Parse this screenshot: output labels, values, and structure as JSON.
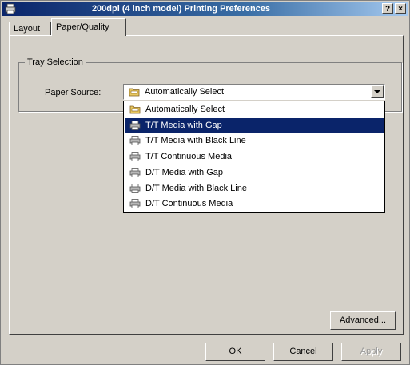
{
  "window": {
    "title": "200dpi (4 inch model) Printing Preferences",
    "help_label": "?",
    "close_label": "×"
  },
  "tabs": [
    {
      "label": "Layout"
    },
    {
      "label": "Paper/Quality"
    }
  ],
  "tray_selection": {
    "group_label": "Tray Selection",
    "paper_source_label": "Paper Source:",
    "selected_value": "Automatically Select",
    "options": [
      {
        "label": "Automatically Select",
        "icon": "folder-tray-icon"
      },
      {
        "label": "T/T  Media with Gap",
        "icon": "printer-icon",
        "selected": true
      },
      {
        "label": "T/T  Media with Black Line",
        "icon": "printer-icon"
      },
      {
        "label": "T/T  Continuous Media",
        "icon": "printer-icon"
      },
      {
        "label": "D/T  Media with Gap",
        "icon": "printer-icon"
      },
      {
        "label": "D/T  Media with Black Line",
        "icon": "printer-icon"
      },
      {
        "label": "D/T  Continuous Media",
        "icon": "printer-icon"
      }
    ]
  },
  "buttons": {
    "advanced": "Advanced...",
    "ok": "OK",
    "cancel": "Cancel",
    "apply": "Apply"
  },
  "colors": {
    "selection": "#0a246a",
    "face": "#d4d0c8"
  }
}
